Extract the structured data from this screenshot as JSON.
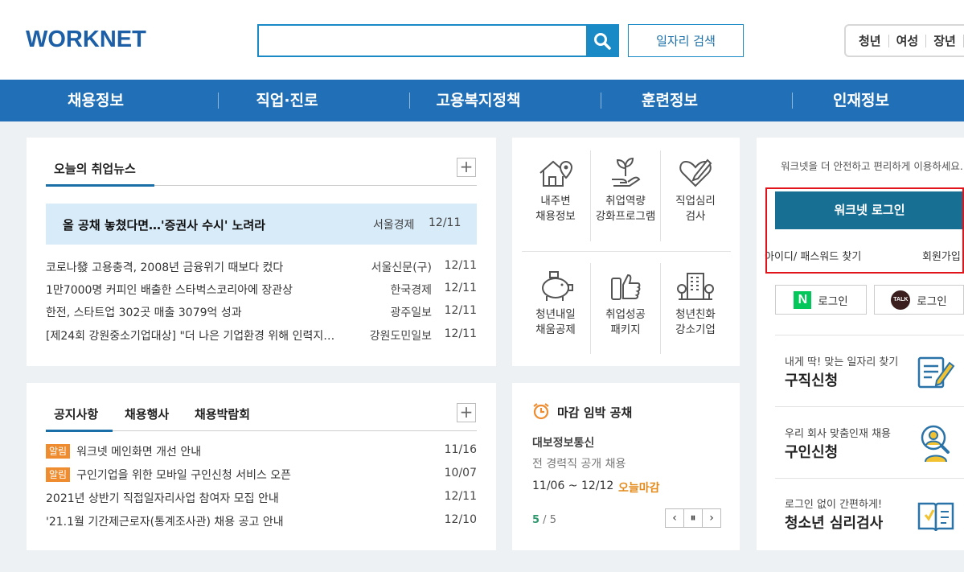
{
  "header": {
    "logo": "WORKNET",
    "search_placeholder": "",
    "job_search_label": "일자리 검색",
    "quick_tabs": [
      "청년",
      "여성",
      "장년"
    ]
  },
  "gnb": [
    "채용정보",
    "직업·진로",
    "고용복지정책",
    "훈련정보",
    "인재정보"
  ],
  "news": {
    "tab": "오늘의 취업뉴스",
    "headline": {
      "title": "올 공채 놓쳤다면…'증권사 수시' 노려라",
      "source": "서울경제",
      "date": "12/11"
    },
    "items": [
      {
        "title": "코로나發 고용충격, 2008년 금융위기 때보다 컸다",
        "source": "서울신문(구)",
        "date": "12/11"
      },
      {
        "title": "1만7000명 커피인 배출한 스타벅스코리아에 장관상",
        "source": "한국경제",
        "date": "12/11"
      },
      {
        "title": "한전, 스타트업 302곳 매출 3079억 성과",
        "source": "광주일보",
        "date": "12/11"
      },
      {
        "title": "[제24회 강원중소기업대상] \"더 나은 기업환경 위해 인력지…",
        "source": "강원도민일보",
        "date": "12/11"
      }
    ]
  },
  "notice": {
    "tabs": [
      "공지사항",
      "채용행사",
      "채용박람회"
    ],
    "items": [
      {
        "badge": "알림",
        "title": "워크넷 메인화면 개선 안내",
        "date": "11/16"
      },
      {
        "badge": "알림",
        "title": "구인기업을 위한 모바일 구인신청 서비스 오픈",
        "date": "10/07"
      },
      {
        "badge": "",
        "title": "2021년 상반기 직접일자리사업 참여자 모집 안내",
        "date": "12/11"
      },
      {
        "badge": "",
        "title": "'21.1월 기간제근로자(통계조사관) 채용 공고 안내",
        "date": "12/10"
      }
    ]
  },
  "quick_menu": [
    {
      "line1": "내주변",
      "line2": "채용정보",
      "icon": "house-pin-icon"
    },
    {
      "line1": "취업역량",
      "line2": "강화프로그램",
      "icon": "sprout-hand-icon"
    },
    {
      "line1": "직업심리",
      "line2": "검사",
      "icon": "heart-pen-icon"
    },
    {
      "line1": "청년내일",
      "line2": "채움공제",
      "icon": "piggy-bank-icon"
    },
    {
      "line1": "취업성공",
      "line2": "패키지",
      "icon": "thumbs-up-icon"
    },
    {
      "line1": "청년친화",
      "line2": "강소기업",
      "icon": "building-icon"
    }
  ],
  "deadline": {
    "title": "마감 임박 공채",
    "company": "대보정보통신",
    "description": "전 경력직 공개 채용",
    "date": "11/06 ~ 12/12",
    "tag": "오늘마감",
    "page_current": "5",
    "page_sep": " / ",
    "page_total": "5"
  },
  "login": {
    "message": "워크넷을 더 안전하고 편리하게 이용하세요.",
    "login_button": "워크넷 로그인",
    "find_id": "아이디/ 패스워드 찾기",
    "join": "회원가입",
    "naver_login": "로그인",
    "kakao_login": "로그인",
    "naver_mark": "N",
    "kakao_mark": "TALK"
  },
  "services": [
    {
      "sub": "내게 딱! 맞는 일자리 찾기",
      "main": "구직신청",
      "icon": "resume-pen-icon"
    },
    {
      "sub": "우리 회사 맞춤인재 채용",
      "main": "구인신청",
      "icon": "person-search-icon"
    },
    {
      "sub": "로그인 없이 간편하게!",
      "main": "청소년 심리검사",
      "icon": "book-check-icon"
    }
  ],
  "colors": {
    "brand_blue": "#2170b7",
    "login_teal": "#176f93",
    "badge_orange": "#ef8c2f",
    "highlight_red": "#e2141b"
  }
}
